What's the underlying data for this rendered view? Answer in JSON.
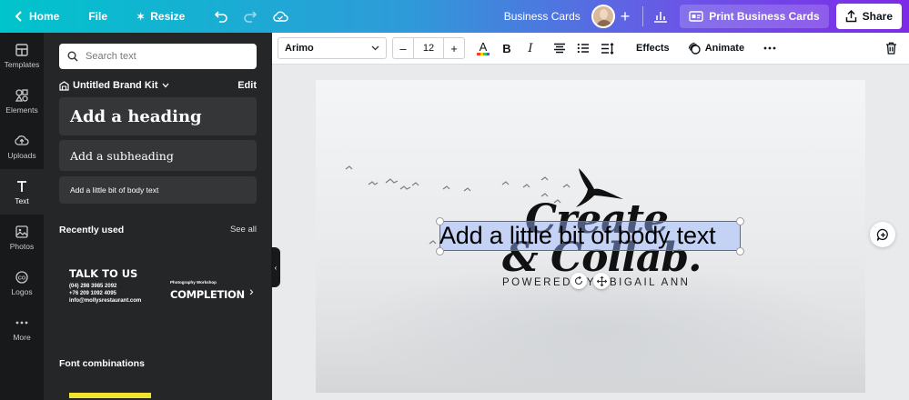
{
  "topbar": {
    "home_label": "Home",
    "file_label": "File",
    "resize_label": "Resize",
    "doc_title": "Business Cards",
    "print_label": "Print Business Cards",
    "share_label": "Share"
  },
  "rail": {
    "items": [
      {
        "label": "Templates",
        "icon": "templates-icon"
      },
      {
        "label": "Elements",
        "icon": "elements-icon"
      },
      {
        "label": "Uploads",
        "icon": "uploads-icon"
      },
      {
        "label": "Text",
        "icon": "text-icon"
      },
      {
        "label": "Photos",
        "icon": "photos-icon"
      },
      {
        "label": "Logos",
        "icon": "logos-icon"
      },
      {
        "label": "More",
        "icon": "more-icon"
      }
    ],
    "active": "Text"
  },
  "panel": {
    "search_placeholder": "Search text",
    "brand_kit": "Untitled Brand Kit",
    "edit_label": "Edit",
    "heading_tile": "Add a heading",
    "subheading_tile": "Add a subheading",
    "body_tile": "Add a little bit of body text",
    "recently_used_label": "Recently used",
    "see_all_label": "See all",
    "recent1": {
      "title": "TALK TO US",
      "line1": "(04) 298 3985 2092",
      "line2": "+76 209 1092 4095",
      "line3": "info@mollysrestaurant.com"
    },
    "recent2": {
      "small": "Photography Workshop",
      "big": "COMPLETION"
    },
    "font_combinations_label": "Font combinations"
  },
  "toolbar": {
    "font_name": "Arimo",
    "font_size": "12",
    "effects_label": "Effects",
    "animate_label": "Animate"
  },
  "canvas": {
    "logo_line1": "Create",
    "logo_line2": "& Collab.",
    "powered_text": "POWERED BY ABIGAIL ANN",
    "selected_text": "Add a little bit of body text"
  },
  "colors": {
    "selection": "#8b3dff",
    "panel_bg": "#252627",
    "rail_bg": "#18191b"
  }
}
